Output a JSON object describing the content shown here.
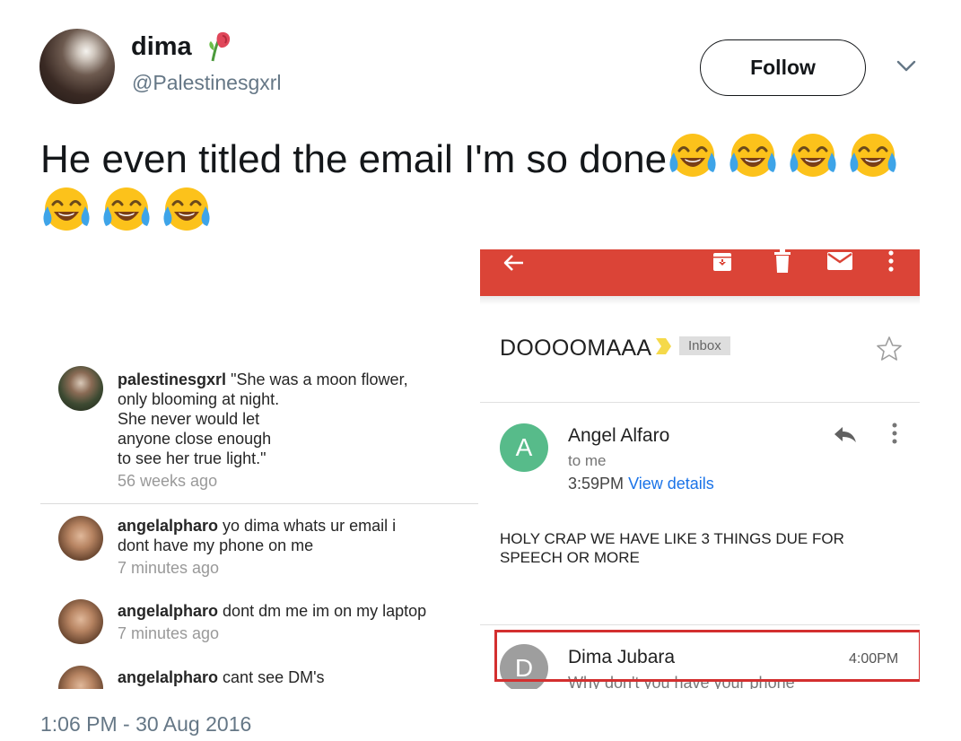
{
  "tweet": {
    "display_name": "dima",
    "handle": "@Palestinesgxrl",
    "follow_label": "Follow",
    "text": "He even titled the email I'm so done",
    "emoji_count": 7,
    "timestamp": "1:06 PM - 30 Aug 2016"
  },
  "icons": {
    "name_emoji": "wilted-rose-icon",
    "text_emoji": "face-with-tears-of-joy-icon",
    "caret": "chevron-down-icon"
  },
  "instagram": {
    "comments": [
      {
        "user": "palestinesgxrl",
        "text": "\"She was a moon flower,\nonly blooming at night.\nShe never would let\nanyone close enough\nto see her true light.\"",
        "time": "56 weeks ago"
      },
      {
        "user": "angelalpharo",
        "text": "yo dima whats ur email i\ndont have my phone on me",
        "time": "7 minutes ago"
      },
      {
        "user": "angelalpharo",
        "text": "dont dm me im on my laptop",
        "time": "7 minutes ago"
      },
      {
        "user": "angelalpharo",
        "text": "cant see DM's",
        "time": ""
      }
    ]
  },
  "gmail": {
    "toolbar_color": "#db4437",
    "subject": "DOOOOMAAA",
    "label": "Inbox",
    "message1": {
      "avatar_letter": "A",
      "sender": "Angel Alfaro",
      "to": "to me",
      "time": "3:59PM",
      "view_details": "View details",
      "body": "HOLY CRAP WE HAVE LIKE 3 THINGS DUE FOR SPEECH OR MORE"
    },
    "message2": {
      "avatar_letter": "D",
      "sender": "Dima Jubara",
      "time": "4:00PM",
      "snippet": "Why don't you have your phone"
    }
  }
}
